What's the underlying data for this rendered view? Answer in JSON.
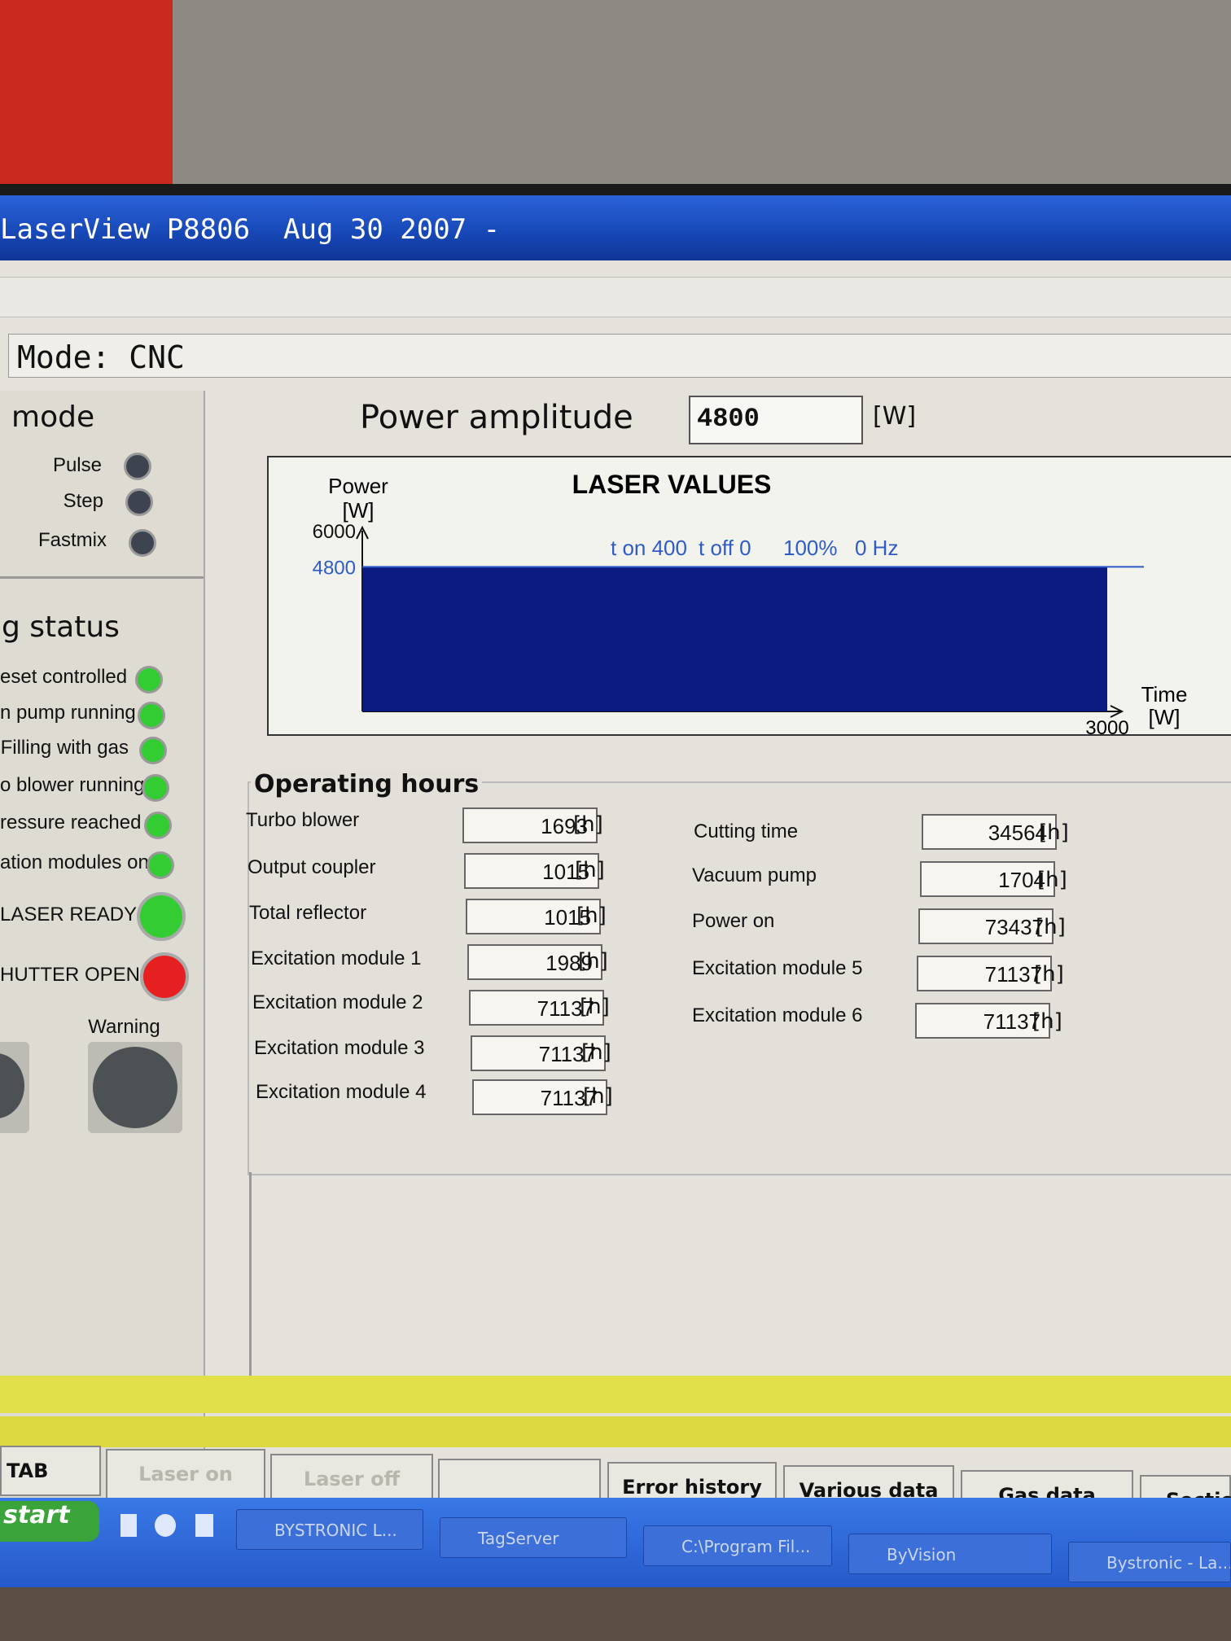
{
  "window": {
    "title": "LaserView P8806  Aug 30 2007 -"
  },
  "mode_bar": {
    "text": "Mode: CNC"
  },
  "left": {
    "mode_title": "mode",
    "mode_items": [
      {
        "label": "Pulse"
      },
      {
        "label": "Step"
      },
      {
        "label": "Fastmix"
      }
    ],
    "status_title": "g status",
    "status_items": [
      {
        "label": "eset controlled"
      },
      {
        "label": "n pump running"
      },
      {
        "label": "Filling with gas"
      },
      {
        "label": "o blower running"
      },
      {
        "label": "ressure reached"
      },
      {
        "label": "ation modules on"
      }
    ],
    "laser_ready": "LASER READY",
    "shutter_open": "HUTTER OPEN",
    "warning": "Warning"
  },
  "power": {
    "label": "Power amplitude",
    "value": "4800",
    "unit": "[W]"
  },
  "chart_data": {
    "type": "area",
    "title": "LASER VALUES",
    "ylabel": "Power\n[W]",
    "xlabel": "Time\n[W]",
    "y_ticks": [
      "6000",
      "4800"
    ],
    "x_tick": "3000",
    "ylim": [
      0,
      6000
    ],
    "xlim": [
      0,
      3000
    ],
    "x": [
      0,
      3000
    ],
    "values": [
      4800,
      4800
    ],
    "annotations": [
      "t on 400",
      "t off 0",
      "100%",
      "0 Hz"
    ],
    "colors": {
      "fill": "#0a1a80",
      "annotation": "#2e5cc4"
    }
  },
  "operating_hours": {
    "title": "Operating hours",
    "left": [
      {
        "label": "Turbo blower",
        "value": "1693",
        "unit": "[h]"
      },
      {
        "label": "Output coupler",
        "value": "1015",
        "unit": "[h]"
      },
      {
        "label": "Total reflector",
        "value": "1015",
        "unit": "[h]"
      },
      {
        "label": "Excitation module 1",
        "value": "1989",
        "unit": "[h]"
      },
      {
        "label": "Excitation module 2",
        "value": "71137",
        "unit": "[h]"
      },
      {
        "label": "Excitation module 3",
        "value": "71137",
        "unit": "[h]"
      },
      {
        "label": "Excitation module 4",
        "value": "71137",
        "unit": "[h]"
      }
    ],
    "right": [
      {
        "label": "Cutting time",
        "value": "34564",
        "unit": "[h]"
      },
      {
        "label": "Vacuum pump",
        "value": "1704",
        "unit": "[h]"
      },
      {
        "label": "Power on",
        "value": "73437",
        "unit": "[h]"
      },
      {
        "label": "Excitation module 5",
        "value": "71137",
        "unit": "[h]"
      },
      {
        "label": "Excitation module 6",
        "value": "71137",
        "unit": "[h]"
      }
    ]
  },
  "function_keys": [
    {
      "label": "TAB"
    },
    {
      "label": "Laser on"
    },
    {
      "label": "Laser off"
    },
    {
      "label": ""
    },
    {
      "label": "Error history"
    },
    {
      "label": "Various data"
    },
    {
      "label": "Gas data"
    },
    {
      "label": "Sectio"
    }
  ],
  "taskbar": {
    "start": "start",
    "items": [
      {
        "label": "BYSTRONIC L..."
      },
      {
        "label": "TagServer"
      },
      {
        "label": "C:\\Program Fil..."
      },
      {
        "label": "ByVision"
      },
      {
        "label": "Bystronic - La..."
      }
    ]
  }
}
